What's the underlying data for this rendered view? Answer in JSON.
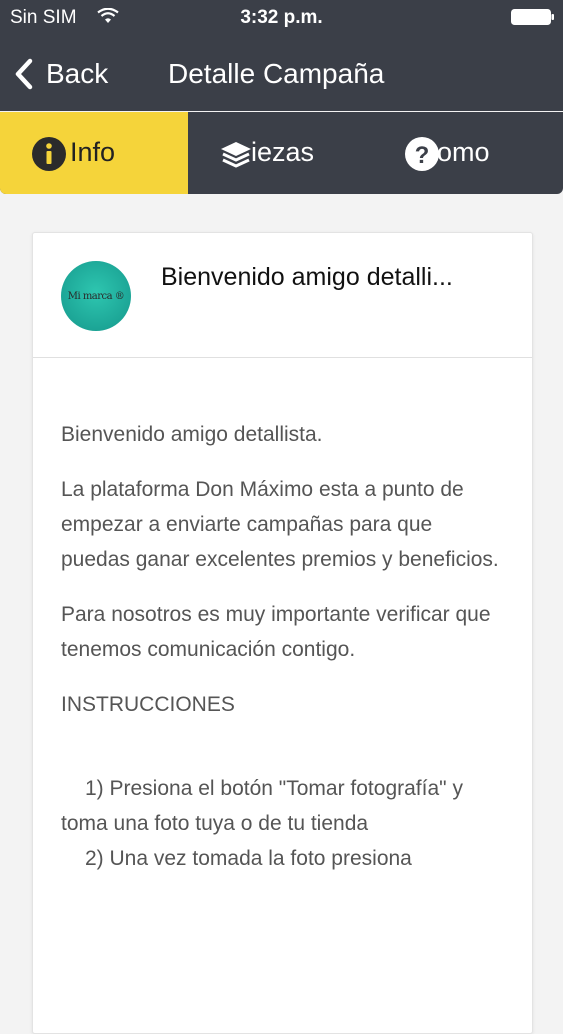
{
  "status_bar": {
    "carrier": "Sin SIM",
    "time": "3:32 p.m."
  },
  "nav": {
    "back_label": "Back",
    "title": "Detalle Campaña"
  },
  "tabs": [
    {
      "label": "Info",
      "icon": "info-circle-icon",
      "active": true
    },
    {
      "label": "iezas",
      "icon": "layers-icon",
      "active": false
    },
    {
      "label": "omo",
      "icon": "question-circle-icon",
      "active": false
    }
  ],
  "card": {
    "avatar_text": "Mi marca ®",
    "title": "Bienvenido amigo detalli...",
    "paragraphs": [
      "Bienvenido amigo detallista.",
      "La plataforma Don Máximo esta a punto de empezar a enviarte campañas para que puedas ganar excelentes premios y beneficios.",
      "Para nosotros es muy importante verificar que tenemos comunicación contigo.",
      "INSTRUCCIONES",
      "1) Presiona el botón \"Tomar fotografía\" y toma una foto tuya o de tu tienda",
      "2) Una vez tomada la foto presiona"
    ]
  },
  "colors": {
    "bar": "#3b3f48",
    "accent": "#f5d43a",
    "avatar": "#1ca596"
  }
}
